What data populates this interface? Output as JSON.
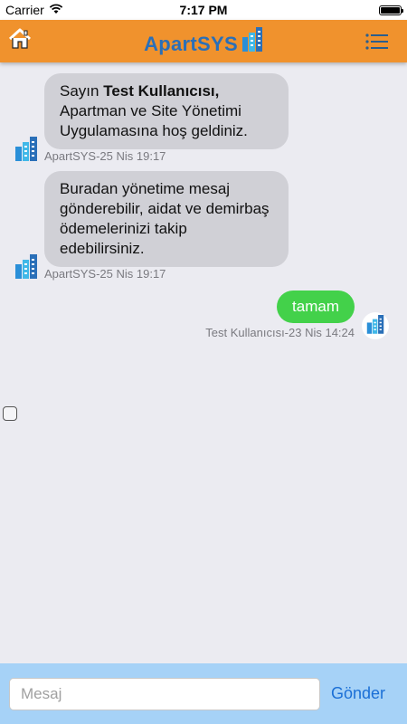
{
  "status_bar": {
    "carrier": "Carrier",
    "time": "7:17 PM",
    "wifi_icon": "wifi-icon",
    "battery_icon": "battery-icon",
    "battery_level": 1.0
  },
  "header": {
    "title": "ApartSYS",
    "home_icon": "home-icon",
    "menu_icon": "list-menu-icon",
    "background_color": "#f0922d",
    "title_color": "#2a6fb8"
  },
  "messages": [
    {
      "direction": "incoming",
      "text_prefix": "Sayın ",
      "text_bold": "Test Kullanıcısı,",
      "text_rest": " Apartman ve Site Yönetimi Uygulamasına hoş geldiniz.",
      "meta": "ApartSYS-25 Nis 19:17",
      "avatar_icon": "building-icon"
    },
    {
      "direction": "incoming",
      "text": "Buradan yönetime mesaj gönderebilir, aidat ve demirbaş ödemelerinizi takip edebilirsiniz.",
      "meta": "ApartSYS-25 Nis 19:17",
      "avatar_icon": "building-icon"
    },
    {
      "direction": "outgoing",
      "text": "tamam",
      "meta": "Test Kullanıcısı-23 Nis 14:24",
      "avatar_icon": "building-icon"
    }
  ],
  "colors": {
    "incoming_bubble": "#d0d0d6",
    "outgoing_bubble": "#43d14a",
    "input_bar": "#a6d2f7",
    "send_text": "#1a6fd6"
  },
  "composer": {
    "placeholder": "Mesaj",
    "value": "",
    "send_label": "Gönder"
  }
}
